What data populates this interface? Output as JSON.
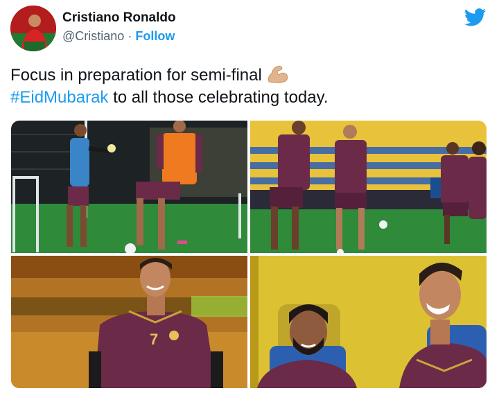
{
  "author": {
    "name": "Cristiano Ronaldo",
    "handle": "@Cristiano",
    "separator": "·",
    "follow_label": "Follow"
  },
  "tweet": {
    "line1": "Focus in preparation for semi-final",
    "hashtag": "#EidMubarak",
    "line2_rest": " to all those celebrating today."
  },
  "jersey_number": "7",
  "colors": {
    "twitter_blue": "#1d9bf0",
    "kit_maroon": "#6b2a47",
    "bib_orange": "#f07a1f",
    "bib_blue": "#3a84c8",
    "pitch_green": "#2f8a3a",
    "stand_yellow": "#e9c23b"
  },
  "icons": [
    "avatar-image",
    "twitter-bird-icon",
    "flexed-biceps-emoji"
  ]
}
